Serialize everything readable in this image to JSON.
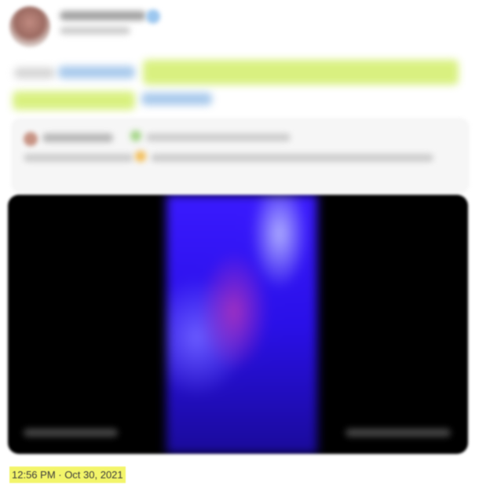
{
  "tweet": {
    "timestamp": "12:56 PM · Oct 30, 2021"
  },
  "colors": {
    "highlight": "#d7f07a",
    "timestamp_highlight": "#f3f56a",
    "link_blue": "#9fc4ea",
    "media_bg": "#000000",
    "video_blue": "#3a1aff"
  },
  "icons": [
    "verified-badge-icon"
  ]
}
